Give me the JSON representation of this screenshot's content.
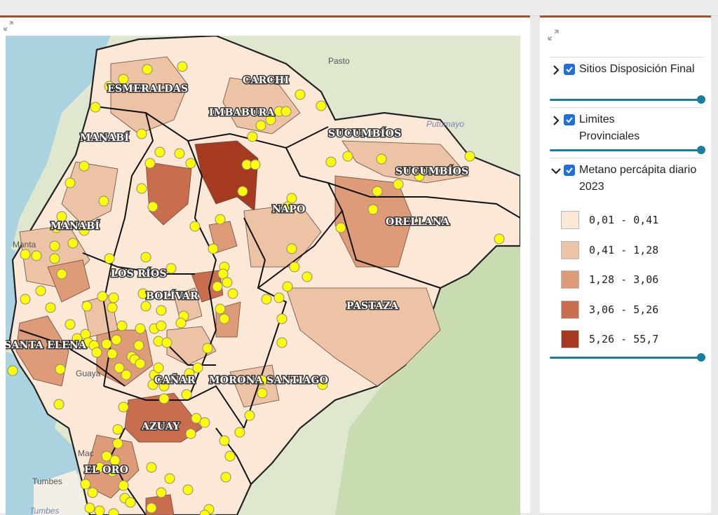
{
  "map": {
    "expand_icon": "expand-arrows-icon",
    "province_labels": [
      "ESMERALDAS",
      "CARCHI",
      "IMBABURA",
      "MANABÍ",
      "MANABÍ",
      "SUCUMBÍOS",
      "SUCUMBÍOS",
      "NAPO",
      "ORELLANA",
      "LOS RÍOS",
      "BOLÍVAR",
      "PASTAZA",
      "SANTA ELENA",
      "CAÑAR",
      "MORONA SANTIAGO",
      "AZUAY",
      "EL ORO"
    ],
    "basemap_labels": [
      "Pasto",
      "Putumayo",
      "Manta",
      "Guaya",
      "Mac",
      "Tumbes",
      "Tumbes"
    ],
    "colors": {
      "class1": "#fbe8d7",
      "class2": "#edc3a6",
      "class3": "#dd9b78",
      "class4": "#c86e4e",
      "class5": "#a53a20",
      "points": "#ffff00",
      "water": "#aad3df",
      "land": "#dfe8cf"
    }
  },
  "legend": {
    "expand_icon": "expand-arrows-icon",
    "layers": [
      {
        "title": "Sitios Disposición Final",
        "checked": true,
        "expanded": false
      },
      {
        "title": "Limites Provinciales",
        "checked": true,
        "expanded": false
      },
      {
        "title": "Metano percápita diario 2023",
        "checked": true,
        "expanded": true
      }
    ],
    "classes": [
      {
        "label": "0,01 - 0,41",
        "color": "#fbe8d7"
      },
      {
        "label": "0,41 - 1,28",
        "color": "#edc3a6"
      },
      {
        "label": "1,28 - 3,06",
        "color": "#dd9b78"
      },
      {
        "label": "3,06 - 5,26",
        "color": "#c86e4e"
      },
      {
        "label": "5,26 - 55,7",
        "color": "#a53a20"
      }
    ]
  }
}
